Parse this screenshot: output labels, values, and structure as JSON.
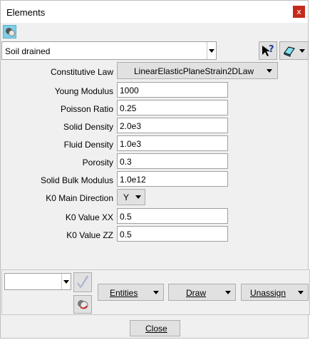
{
  "window": {
    "title": "Elements",
    "close_glyph": "x"
  },
  "condition_select": {
    "value": "Soil drained"
  },
  "toolbar": {
    "help_icon": "pointer-help-icon",
    "help_glyph": "?",
    "view_icon": "layer-icon"
  },
  "properties": [
    {
      "label": "Constitutive Law",
      "value": "LinearElasticPlaneStrain2DLaw",
      "kind": "select"
    },
    {
      "label": "Young Modulus",
      "value": "1000",
      "kind": "text"
    },
    {
      "label": "Poisson Ratio",
      "value": "0.25",
      "kind": "text"
    },
    {
      "label": "Solid Density",
      "value": "2.0e3",
      "kind": "text"
    },
    {
      "label": "Fluid Density",
      "value": "1.0e3",
      "kind": "text"
    },
    {
      "label": "Porosity",
      "value": "0.3",
      "kind": "text"
    },
    {
      "label": "Solid Bulk Modulus",
      "value": "1.0e12",
      "kind": "text"
    },
    {
      "label": "K0 Main Direction",
      "value": "Y",
      "kind": "select"
    },
    {
      "label": "K0 Value XX",
      "value": "0.5",
      "kind": "text"
    },
    {
      "label": "K0 Value ZZ",
      "value": "0.5",
      "kind": "text"
    }
  ],
  "bottom": {
    "group_select_value": "",
    "entities_label": "Entities",
    "draw_label": "Draw",
    "unassign_label": "Unassign",
    "close_label": "Close"
  },
  "colors": {
    "close_bg": "#c42b1c",
    "icon_bg": "#7fd0e6",
    "panel_bg": "#f0f0f0"
  }
}
